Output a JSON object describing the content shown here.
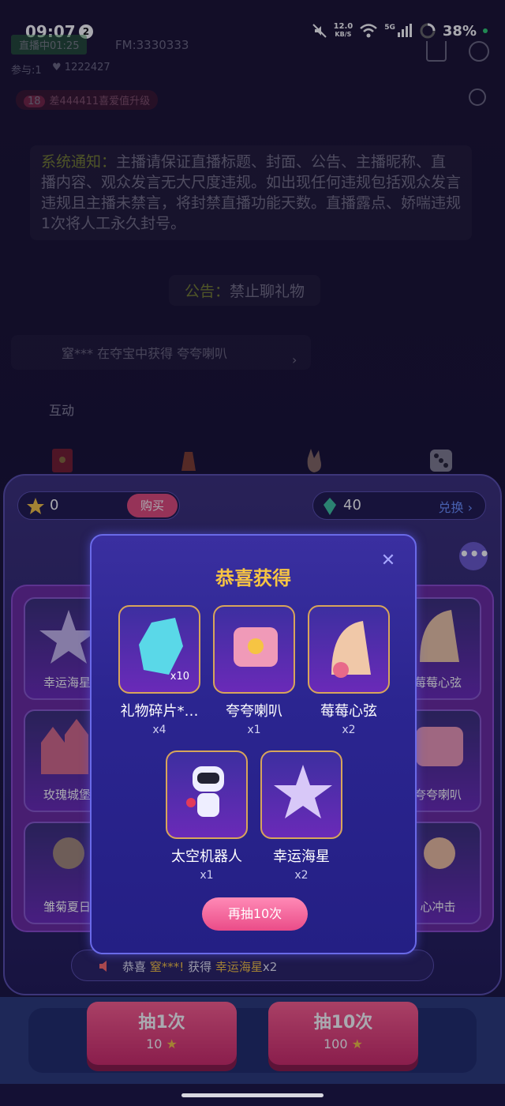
{
  "status_bar": {
    "time": "09:07",
    "notif_count": "2",
    "net_speed": "12.0",
    "net_unit": "KB/S",
    "signal": "5G",
    "battery": "38%"
  },
  "live": {
    "live_label": "直播中01:25",
    "fm": "FM:3330333",
    "joined": "参与:1",
    "likes": "1222427",
    "level": "18",
    "level_text": "差444411喜爱值升级"
  },
  "notice": {
    "title": "系统通知：",
    "body": "主播请保证直播标题、封面、公告、主播昵称、直播内容、观众发言无大尺度违规。如出现任何违规包括观众发言违规且主播未禁言，将封禁直播功能天数。直播露点、娇喘违规1次将人工永久封号。"
  },
  "announcement": {
    "title": "公告：",
    "body": "禁止聊礼物"
  },
  "win_message": "窒*** 在夺宝中获得 夸夸喇叭",
  "tab_interact": "互动",
  "game": {
    "stars_balance": "0",
    "buy_label": "购买",
    "crystal_balance": "40",
    "exchange_label": "兑换",
    "more_label": "•••",
    "grid_items": [
      {
        "label": "幸运海星"
      },
      {
        "label": "莓莓心弦"
      },
      {
        "label": "玫瑰城堡"
      },
      {
        "label": "夸夸喇叭"
      },
      {
        "label": "雏菊夏日"
      },
      {
        "label": "心冲击"
      }
    ],
    "ticker": {
      "prefix": "恭喜 ",
      "user": "窒***!",
      "mid": " 获得 ",
      "prize": "幸运海星",
      "qty": "x2"
    },
    "draw_one": {
      "label": "抽1次",
      "cost": "10"
    },
    "draw_ten": {
      "label": "抽10次",
      "cost": "100"
    }
  },
  "modal": {
    "title": "恭喜获得",
    "prizes": [
      {
        "name": "礼物碎片*…",
        "qty": "x4",
        "badge": "x10"
      },
      {
        "name": "夸夸喇叭",
        "qty": "x1"
      },
      {
        "name": "莓莓心弦",
        "qty": "x2"
      },
      {
        "name": "太空机器人",
        "qty": "x1"
      },
      {
        "name": "幸运海星",
        "qty": "x2"
      }
    ],
    "again_label": "再抽10次"
  },
  "colors": {
    "accent_gold": "#f6c443",
    "button_pink": "#ea4c88",
    "panel_purple": "#2b2590"
  }
}
